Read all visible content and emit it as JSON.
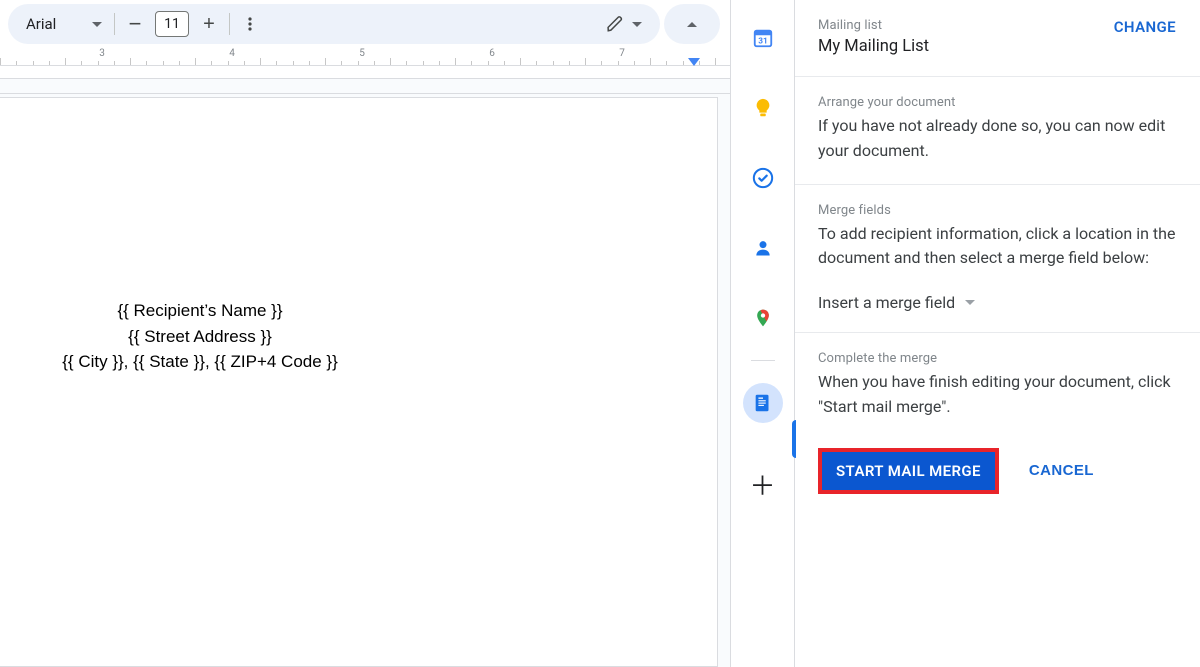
{
  "toolbar": {
    "font_name": "Arial",
    "font_size": "11"
  },
  "ruler": {
    "majors": [
      "3",
      "4",
      "5",
      "6",
      "7"
    ]
  },
  "document": {
    "line1": "{{ Recipient’s Name }}",
    "line2": "{{ Street Address }}",
    "line3": "{{ City }}, {{ State }}, {{ ZIP+4 Code }}"
  },
  "sidepanel": {
    "mailing_list": {
      "label": "Mailing list",
      "value": "My Mailing List",
      "change": "CHANGE"
    },
    "arrange": {
      "label": "Arrange your document",
      "desc": "If you have not already done so, you can now edit your document."
    },
    "merge_fields": {
      "label": "Merge fields",
      "desc": "To add recipient information, click a location in the document and then select a merge field below:",
      "dropdown": "Insert a merge field"
    },
    "complete": {
      "label": "Complete the merge",
      "desc": "When you have finish editing your document, click \"Start mail merge\".",
      "start": "START MAIL MERGE",
      "cancel": "CANCEL"
    }
  },
  "side_icons": {
    "calendar": "calendar-icon",
    "keep": "keep-icon",
    "tasks": "tasks-icon",
    "contacts": "contacts-icon",
    "maps": "maps-icon",
    "merge_app": "mail-merge-icon",
    "add": "get-addons-icon"
  }
}
